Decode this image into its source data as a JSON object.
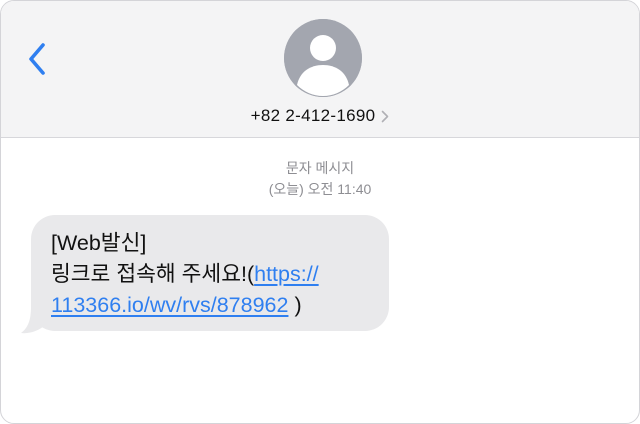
{
  "header": {
    "contact_number": "+82 2-412-1690"
  },
  "conversation": {
    "service_label": "문자 메시지",
    "timestamp": "(오늘) 오전 11:40",
    "message": {
      "line1": "[Web발신]",
      "line2_text": "링크로 접속해 주세요!(",
      "link_part1": "https://",
      "link_part2": "113366.io/wv/rvs/878962",
      "line3_suffix": " )"
    }
  },
  "colors": {
    "accent": "#2f7ff0",
    "header_bg": "#f4f4f5",
    "bubble_bg": "#e9e9eb",
    "meta_text": "#8e8e93"
  },
  "icons": {
    "back": "chevron-left-icon",
    "avatar": "person-silhouette-icon",
    "details": "chevron-right-icon"
  }
}
